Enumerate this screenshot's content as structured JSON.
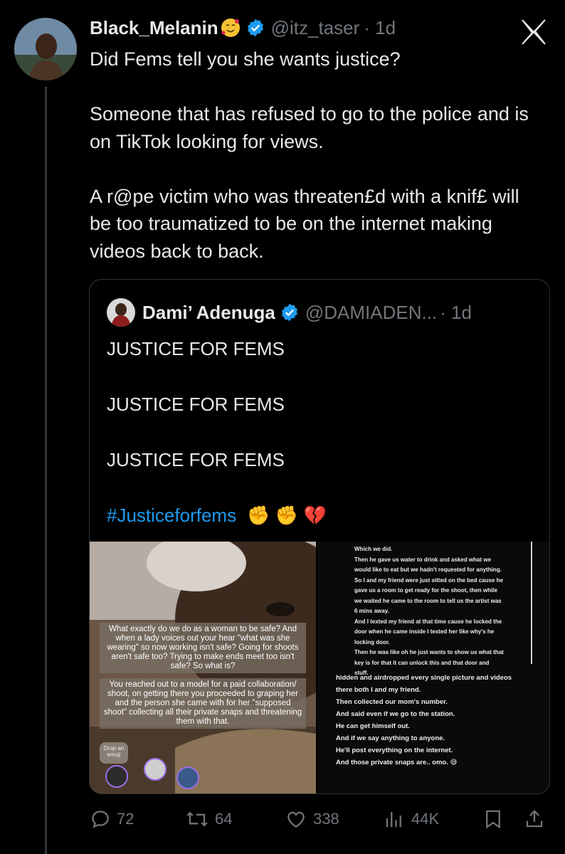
{
  "tweet": {
    "author_name": "Black_Melanin",
    "author_emoji": "smiling-face-with-hearts-emoji",
    "handle": "@itz_taser",
    "time": "· 1d",
    "text": "Did Fems tell you she wants justice?\n\nSomeone that has refused to go to the police and is on TikTok looking for views.\n\nA r@pe victim who was threaten£d with a knif£ will be too traumatized to be on the internet making videos back to back."
  },
  "quote": {
    "author_name": "Dami’ Adenuga",
    "handle": "@DAMIADEN...",
    "time": "· 1d",
    "lines": [
      "JUSTICE FOR FEMS",
      "JUSTICE FOR FEMS",
      "JUSTICE FOR FEMS"
    ],
    "hashtag": "#Justiceforfems",
    "emojis": "✊ ✊ 💔"
  },
  "media": {
    "left_overlay_1": "What exactly do we do as a woman to be safe? And when a lady voices out your hear \"what was she wearing\" so now working isn't safe? Going for shoots aren't safe too? Trying to make ends meet too isn't safe? So what is?",
    "left_overlay_2": "You reached out to a model for a paid collaboration/ shoot, on getting there you proceeded to graping her and the person she came with for her \"supposed shoot\" collecting all their private snaps and threatening them with that.",
    "drop_emoji": "Drop an emoji",
    "right_text_1": "Which we did.\nThen he gave us water to drink and asked what we\nwould like to eat but we hadn't requested for anything.\nSo I and my friend were just sitted on the bed cause he\ngave us a room to get ready for the shoot, then while\nwe waited he came to the room to tell us the artist was\n6 mins away.\nAnd I texted my friend at that time cause he locked the\ndoor when he came inside I texted her like why's he\nlocking door.\nThen he was like oh he just wants to show us what that\nkey is for that it can unlock this and that door and\nstuff.",
    "right_text_2": "hidden and airdropped every single picture and videos\nthere both I and my friend.\nThen collected our mom's number.\nAnd said even if we go to the station.\nHe can get himself out.\nAnd if we say anything to anyone.\nHe'll post everything on the internet.\nAnd those private snaps are.. omo. 😅"
  },
  "actions": {
    "replies": "72",
    "reposts": "64",
    "likes": "338",
    "views": "44K"
  },
  "colors": {
    "background": "#000000",
    "accent": "#1d9bf0",
    "muted": "#71767b"
  }
}
